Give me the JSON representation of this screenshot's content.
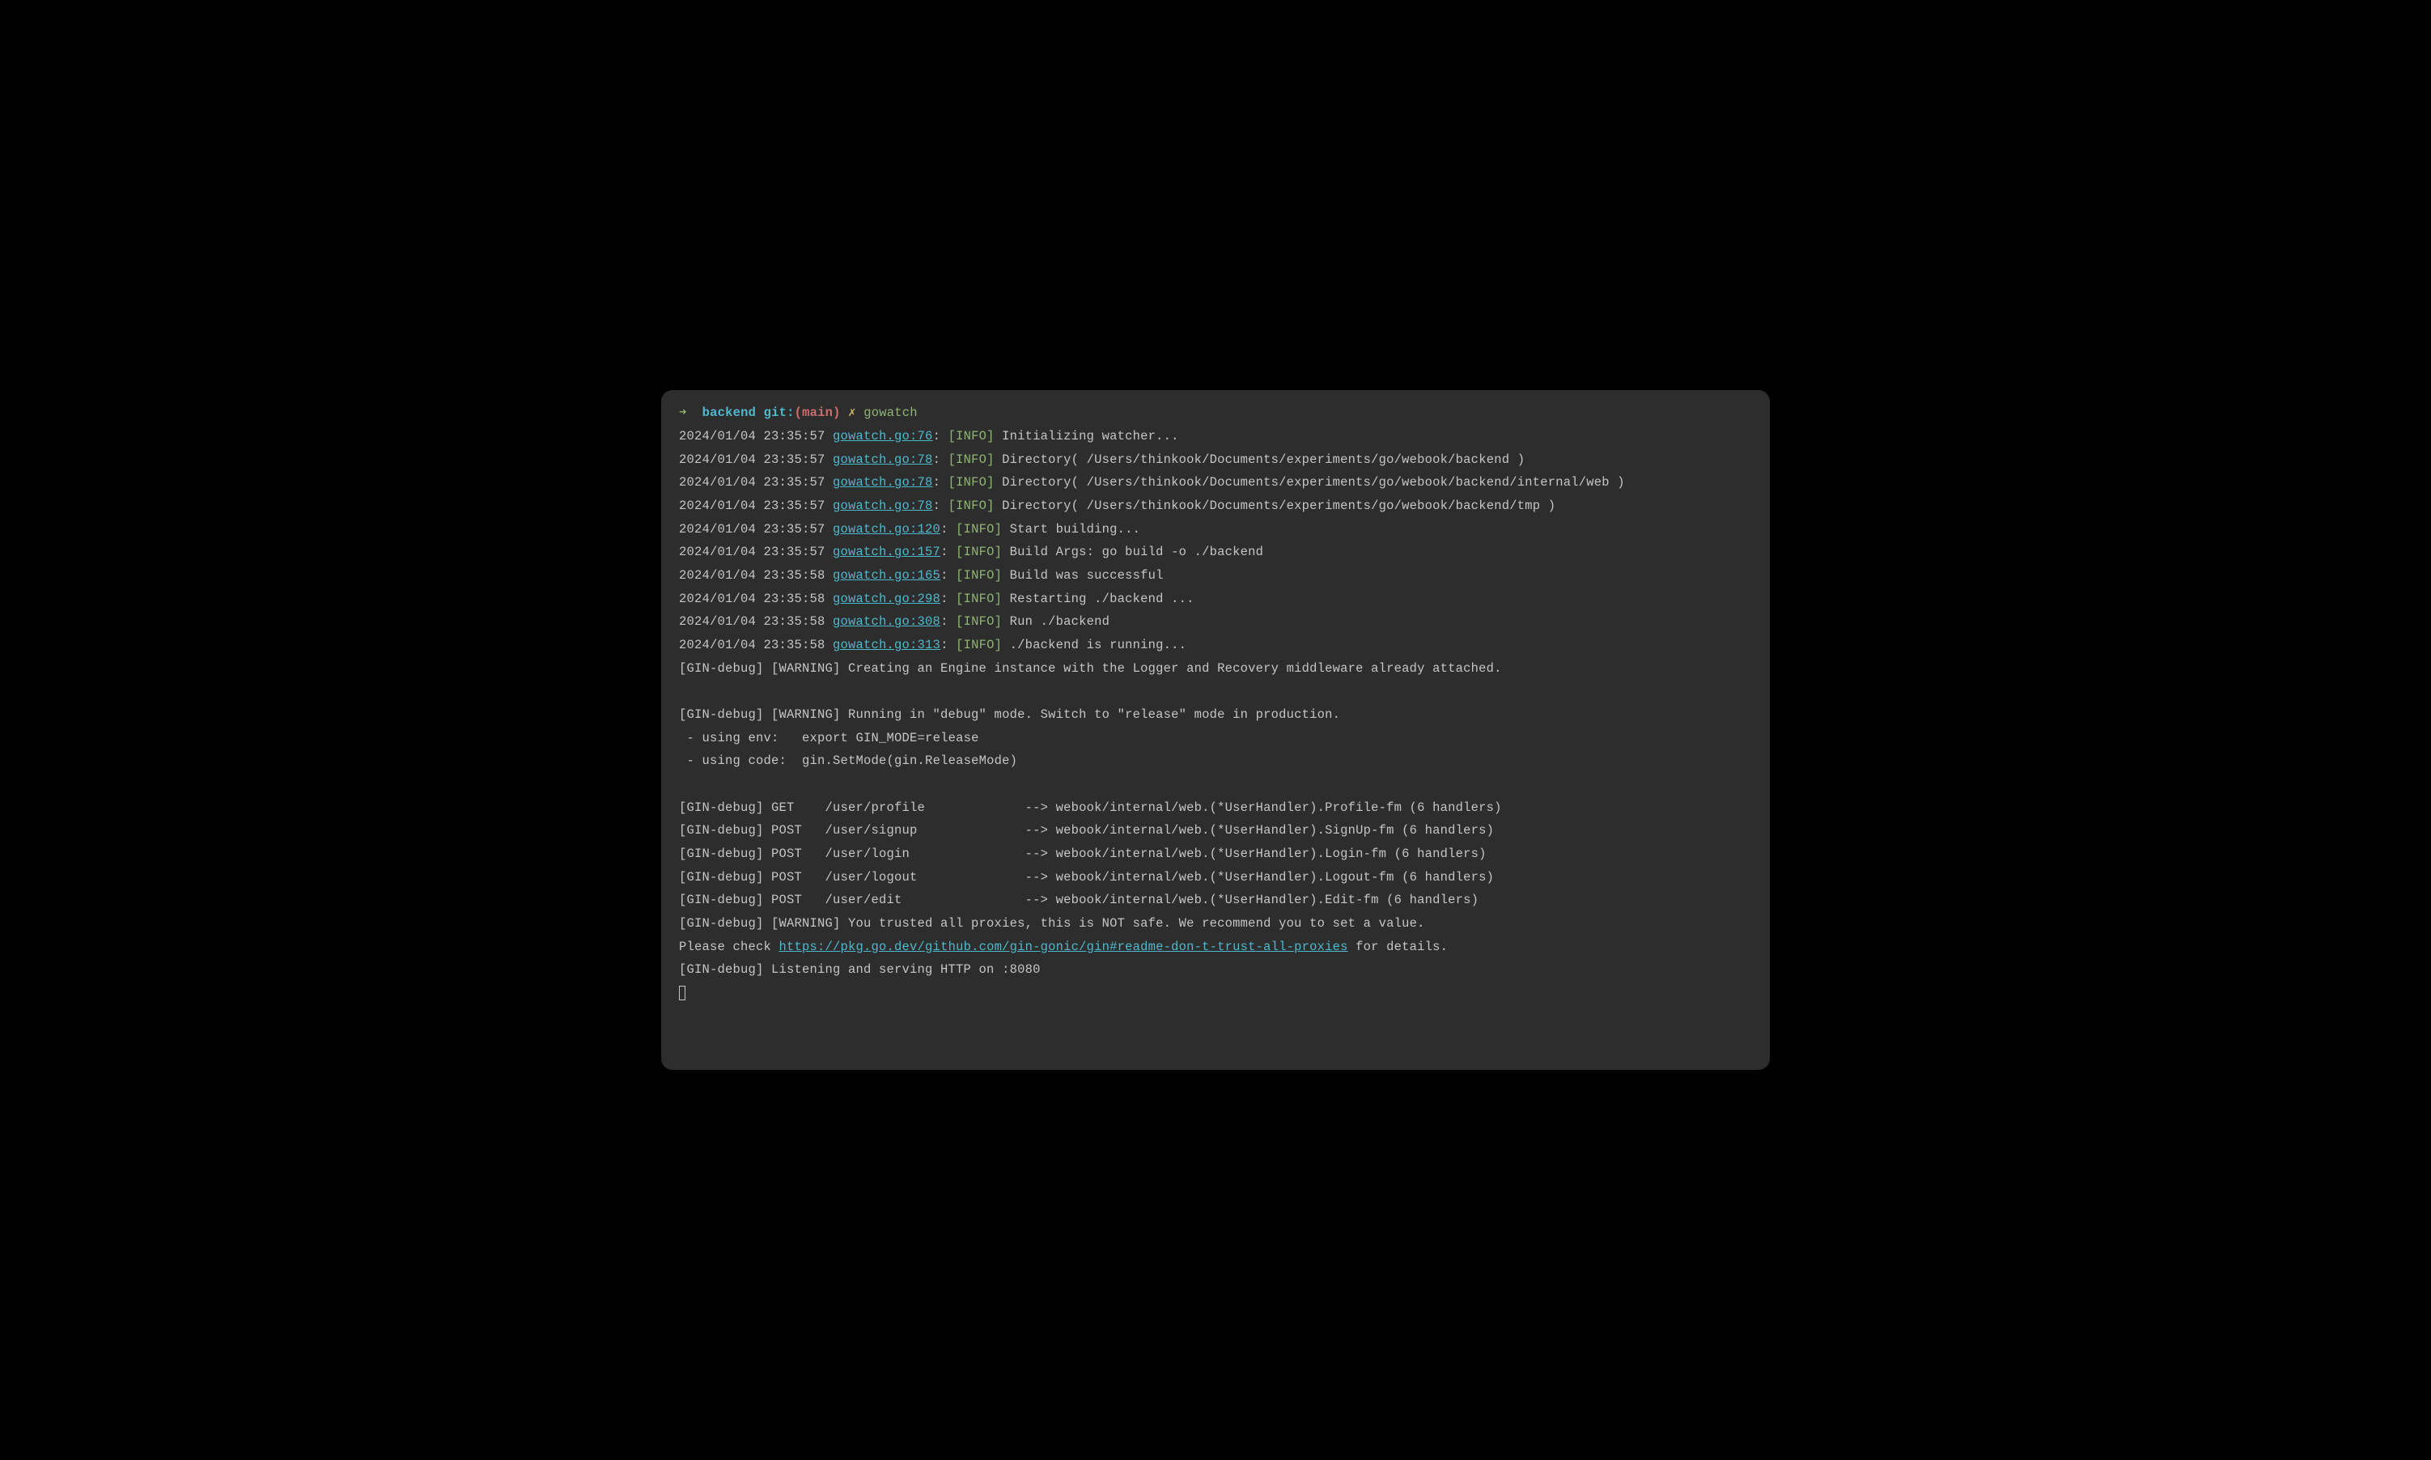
{
  "prompt": {
    "arrow": "➜",
    "dir": "backend",
    "git": "git:",
    "paren_open": "(",
    "branch": "main",
    "paren_close": ")",
    "x": "✗",
    "command": "gowatch"
  },
  "log_lines": [
    {
      "ts": "2024/01/04 23:35:57",
      "file": "gowatch.go:76",
      "level": "[INFO]",
      "msg": "Initializing watcher..."
    },
    {
      "ts": "2024/01/04 23:35:57",
      "file": "gowatch.go:78",
      "level": "[INFO]",
      "msg": "Directory( /Users/thinkook/Documents/experiments/go/webook/backend )"
    },
    {
      "ts": "2024/01/04 23:35:57",
      "file": "gowatch.go:78",
      "level": "[INFO]",
      "msg": "Directory( /Users/thinkook/Documents/experiments/go/webook/backend/internal/web )"
    },
    {
      "ts": "2024/01/04 23:35:57",
      "file": "gowatch.go:78",
      "level": "[INFO]",
      "msg": "Directory( /Users/thinkook/Documents/experiments/go/webook/backend/tmp )"
    },
    {
      "ts": "2024/01/04 23:35:57",
      "file": "gowatch.go:120",
      "level": "[INFO]",
      "msg": "Start building..."
    },
    {
      "ts": "2024/01/04 23:35:57",
      "file": "gowatch.go:157",
      "level": "[INFO]",
      "msg": "Build Args: go build -o ./backend"
    },
    {
      "ts": "2024/01/04 23:35:58",
      "file": "gowatch.go:165",
      "level": "[INFO]",
      "msg": "Build was successful"
    },
    {
      "ts": "2024/01/04 23:35:58",
      "file": "gowatch.go:298",
      "level": "[INFO]",
      "msg": "Restarting ./backend ..."
    },
    {
      "ts": "2024/01/04 23:35:58",
      "file": "gowatch.go:308",
      "level": "[INFO]",
      "msg": "Run ./backend"
    },
    {
      "ts": "2024/01/04 23:35:58",
      "file": "gowatch.go:313",
      "level": "[INFO]",
      "msg": "./backend is running..."
    }
  ],
  "plain_lines": [
    "[GIN-debug] [WARNING] Creating an Engine instance with the Logger and Recovery middleware already attached.",
    "",
    "[GIN-debug] [WARNING] Running in \"debug\" mode. Switch to \"release\" mode in production.",
    " - using env:   export GIN_MODE=release",
    " - using code:  gin.SetMode(gin.ReleaseMode)",
    "",
    "[GIN-debug] GET    /user/profile             --> webook/internal/web.(*UserHandler).Profile-fm (6 handlers)",
    "[GIN-debug] POST   /user/signup              --> webook/internal/web.(*UserHandler).SignUp-fm (6 handlers)",
    "[GIN-debug] POST   /user/login               --> webook/internal/web.(*UserHandler).Login-fm (6 handlers)",
    "[GIN-debug] POST   /user/logout              --> webook/internal/web.(*UserHandler).Logout-fm (6 handlers)",
    "[GIN-debug] POST   /user/edit                --> webook/internal/web.(*UserHandler).Edit-fm (6 handlers)",
    "[GIN-debug] [WARNING] You trusted all proxies, this is NOT safe. We recommend you to set a value."
  ],
  "url_line": {
    "prefix": "Please check ",
    "url": "https://pkg.go.dev/github.com/gin-gonic/gin#readme-don-t-trust-all-proxies",
    "suffix": " for details."
  },
  "final_line": "[GIN-debug] Listening and serving HTTP on :8080"
}
